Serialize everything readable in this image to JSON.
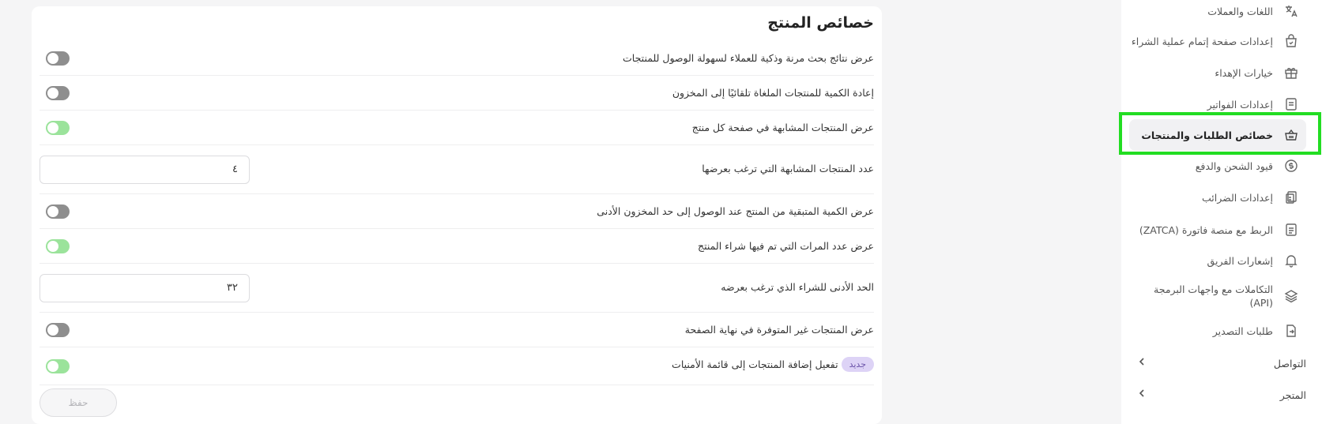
{
  "main": {
    "title": "خصائص المنتج",
    "rows": [
      {
        "label": "عرض نتائج بحث مرنة وذكية للعملاء لسهولة الوصول للمنتجات",
        "toggle": "off"
      },
      {
        "label": "إعادة الكمية للمنتجات الملغاة تلقائيًا إلى المخزون",
        "toggle": "off"
      },
      {
        "label": "عرض المنتجات المشابهة في صفحة كل منتج",
        "toggle": "on"
      },
      {
        "label": "عدد المنتجات المشابهة التي ترغب بعرضها",
        "input_value": "٤"
      },
      {
        "label": "عرض الكمية المتبقية من المنتج عند الوصول إلى حد المخزون الأدنى",
        "toggle": "off"
      },
      {
        "label": "عرض عدد المرات التي تم فيها شراء المنتج",
        "toggle": "on"
      },
      {
        "label": "الحد الأدنى للشراء الذي ترغب بعرضه",
        "input_value": "٣٢"
      },
      {
        "label": "عرض المنتجات غير المتوفرة في نهاية الصفحة",
        "toggle": "off"
      },
      {
        "label": "تفعيل إضافة المنتجات إلى قائمة الأمنيات",
        "badge": "جديد",
        "toggle": "on"
      }
    ],
    "save_label": "حفظ"
  },
  "sidebar": {
    "items": [
      {
        "label": "اللغات والعملات",
        "icon": "translate-icon"
      },
      {
        "label": "إعدادات صفحة إتمام عملية الشراء",
        "icon": "shopping-bag-icon"
      },
      {
        "label": "خيارات الإهداء",
        "icon": "gift-icon"
      },
      {
        "label": "إعدادات الفواتير",
        "icon": "invoice-icon"
      },
      {
        "label": "خصائص الطلبات والمنتجات",
        "icon": "basket-icon",
        "active": true
      },
      {
        "label": "قيود الشحن والدفع",
        "icon": "dollar-circle-icon"
      },
      {
        "label": "إعدادات الضرائب",
        "icon": "tax-icon"
      },
      {
        "label": "الربط مع منصة فاتورة (ZATCA)",
        "icon": "document-icon"
      },
      {
        "label": "إشعارات الفريق",
        "icon": "bell-icon"
      },
      {
        "label_line1": "التكاملات مع واجهات البرمجة",
        "label_line2": "(API)",
        "icon": "layers-icon"
      },
      {
        "label": "طلبات التصدير",
        "icon": "export-icon"
      }
    ],
    "groups": [
      {
        "label": "التواصل",
        "icon": "chevron-left-icon"
      },
      {
        "label": "المتجر",
        "icon": "chevron-left-icon"
      }
    ]
  },
  "colors": {
    "toggle_on": "#9be39b",
    "toggle_off": "#8e8e8e",
    "highlight": "#22dd22",
    "badge_bg": "#ddd3f6"
  }
}
